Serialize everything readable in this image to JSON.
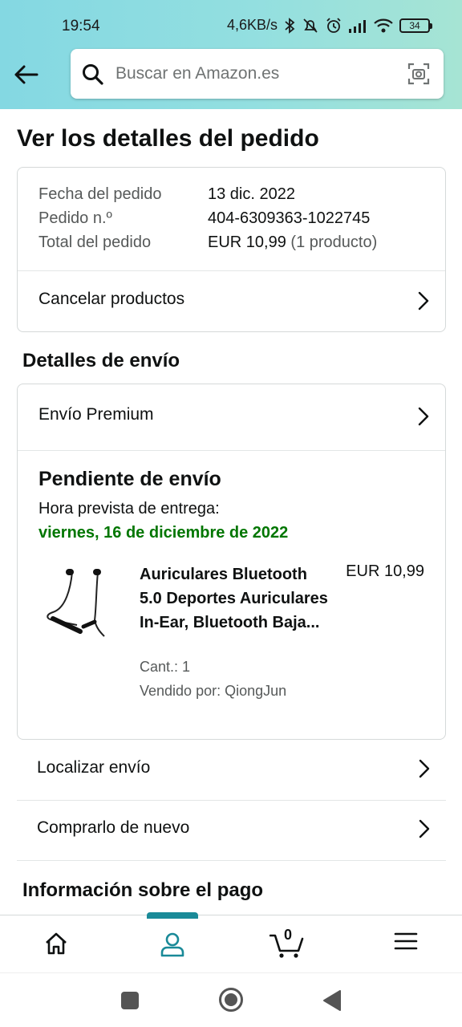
{
  "status_bar": {
    "time": "19:54",
    "network_speed": "4,6KB/s",
    "battery": "34"
  },
  "search": {
    "placeholder": "Buscar en Amazon.es"
  },
  "page": {
    "title": "Ver los detalles del pedido"
  },
  "order_summary": {
    "date_label": "Fecha del pedido",
    "date_value": "13 dic. 2022",
    "number_label": "Pedido n.º",
    "number_value": "404-6309363-1022745",
    "total_label": "Total del pedido",
    "total_value": "EUR 10,99",
    "total_count": "(1 producto)",
    "cancel_label": "Cancelar productos"
  },
  "shipping": {
    "section_title": "Detalles de envío",
    "method": "Envío Premium",
    "status": "Pendiente de envío",
    "eta_label": "Hora prevista de entrega:",
    "eta_date": "viernes, 16 de diciembre de 2022",
    "product": {
      "title": "Auriculares Bluetooth 5.0 Deportes Auriculares In-Ear, Bluetooth Baja...",
      "price": "EUR 10,99",
      "quantity": "Cant.: 1",
      "seller": "Vendido por: QiongJun"
    }
  },
  "actions": {
    "track": "Localizar envío",
    "buy_again": "Comprarlo de nuevo"
  },
  "payment": {
    "section_title": "Información sobre el pago"
  },
  "bottom_nav": {
    "cart_count": "0"
  },
  "colors": {
    "header_gradient_start": "#84d8e2",
    "header_gradient_end": "#a6e4d4",
    "delivery_green": "#007600",
    "nav_active": "#1a8a98"
  }
}
